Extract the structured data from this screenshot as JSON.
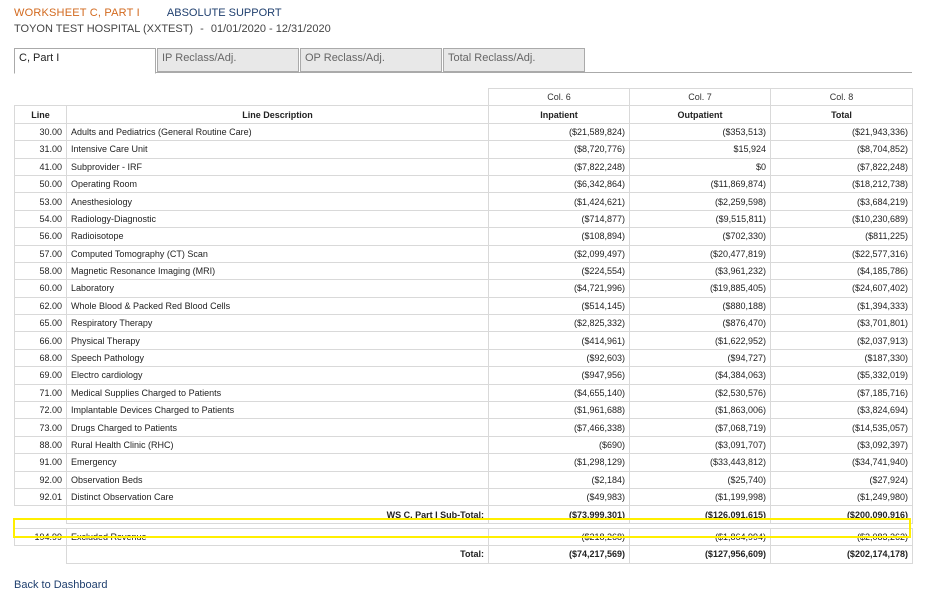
{
  "header": {
    "worksheet": "WORKSHEET C, PART I",
    "support": "ABSOLUTE SUPPORT",
    "hospital": "TOYON TEST HOSPITAL (XXTEST)",
    "separator": "-",
    "period": "01/01/2020 - 12/31/2020"
  },
  "tabs": [
    {
      "label": "C, Part I",
      "active": true
    },
    {
      "label": "IP Reclass/Adj.",
      "active": false
    },
    {
      "label": "OP Reclass/Adj.",
      "active": false
    },
    {
      "label": "Total Reclass/Adj.",
      "active": false
    }
  ],
  "table": {
    "col_numbers": [
      "Col. 6",
      "Col. 7",
      "Col. 8"
    ],
    "headers": [
      "Line",
      "Line Description",
      "Inpatient",
      "Outpatient",
      "Total"
    ],
    "rows": [
      [
        "30.00",
        "Adults and Pediatrics (General Routine Care)",
        "($21,589,824)",
        "($353,513)",
        "($21,943,336)"
      ],
      [
        "31.00",
        "Intensive Care Unit",
        "($8,720,776)",
        "$15,924",
        "($8,704,852)"
      ],
      [
        "41.00",
        "Subprovider - IRF",
        "($7,822,248)",
        "$0",
        "($7,822,248)"
      ],
      [
        "50.00",
        "Operating Room",
        "($6,342,864)",
        "($11,869,874)",
        "($18,212,738)"
      ],
      [
        "53.00",
        "Anesthesiology",
        "($1,424,621)",
        "($2,259,598)",
        "($3,684,219)"
      ],
      [
        "54.00",
        "Radiology-Diagnostic",
        "($714,877)",
        "($9,515,811)",
        "($10,230,689)"
      ],
      [
        "56.00",
        "Radioisotope",
        "($108,894)",
        "($702,330)",
        "($811,225)"
      ],
      [
        "57.00",
        "Computed Tomography (CT) Scan",
        "($2,099,497)",
        "($20,477,819)",
        "($22,577,316)"
      ],
      [
        "58.00",
        "Magnetic Resonance Imaging (MRI)",
        "($224,554)",
        "($3,961,232)",
        "($4,185,786)"
      ],
      [
        "60.00",
        "Laboratory",
        "($4,721,996)",
        "($19,885,405)",
        "($24,607,402)"
      ],
      [
        "62.00",
        "Whole Blood & Packed Red Blood Cells",
        "($514,145)",
        "($880,188)",
        "($1,394,333)"
      ],
      [
        "65.00",
        "Respiratory Therapy",
        "($2,825,332)",
        "($876,470)",
        "($3,701,801)"
      ],
      [
        "66.00",
        "Physical Therapy",
        "($414,961)",
        "($1,622,952)",
        "($2,037,913)"
      ],
      [
        "68.00",
        "Speech Pathology",
        "($92,603)",
        "($94,727)",
        "($187,330)"
      ],
      [
        "69.00",
        "Electro cardiology",
        "($947,956)",
        "($4,384,063)",
        "($5,332,019)"
      ],
      [
        "71.00",
        "Medical Supplies Charged to Patients",
        "($4,655,140)",
        "($2,530,576)",
        "($7,185,716)"
      ],
      [
        "72.00",
        "Implantable Devices Charged to Patients",
        "($1,961,688)",
        "($1,863,006)",
        "($3,824,694)"
      ],
      [
        "73.00",
        "Drugs Charged to Patients",
        "($7,466,338)",
        "($7,068,719)",
        "($14,535,057)"
      ],
      [
        "88.00",
        "Rural Health Clinic (RHC)",
        "($690)",
        "($3,091,707)",
        "($3,092,397)"
      ],
      [
        "91.00",
        "Emergency",
        "($1,298,129)",
        "($33,443,812)",
        "($34,741,940)"
      ],
      [
        "92.00",
        "Observation Beds",
        "($2,184)",
        "($25,740)",
        "($27,924)"
      ],
      [
        "92.01",
        "Distinct Observation Care",
        "($49,983)",
        "($1,199,998)",
        "($1,249,980)"
      ]
    ],
    "subtotal": {
      "label": "WS C, Part I Sub-Total:",
      "inpatient": "($73,999,301)",
      "outpatient": "($126,091,615)",
      "total": "($200,090,916)"
    },
    "excluded": {
      "line": "194.99",
      "desc": "Excluded Revenue",
      "inpatient": "($218,268)",
      "outpatient": "($1,864,994)",
      "total": "($2,083,262)"
    },
    "total": {
      "label": "Total:",
      "inpatient": "($74,217,569)",
      "outpatient": "($127,956,609)",
      "total": "($202,174,178)"
    }
  },
  "highlight_color": "#ffef00",
  "footer": {
    "back_link": "Back to Dashboard"
  }
}
